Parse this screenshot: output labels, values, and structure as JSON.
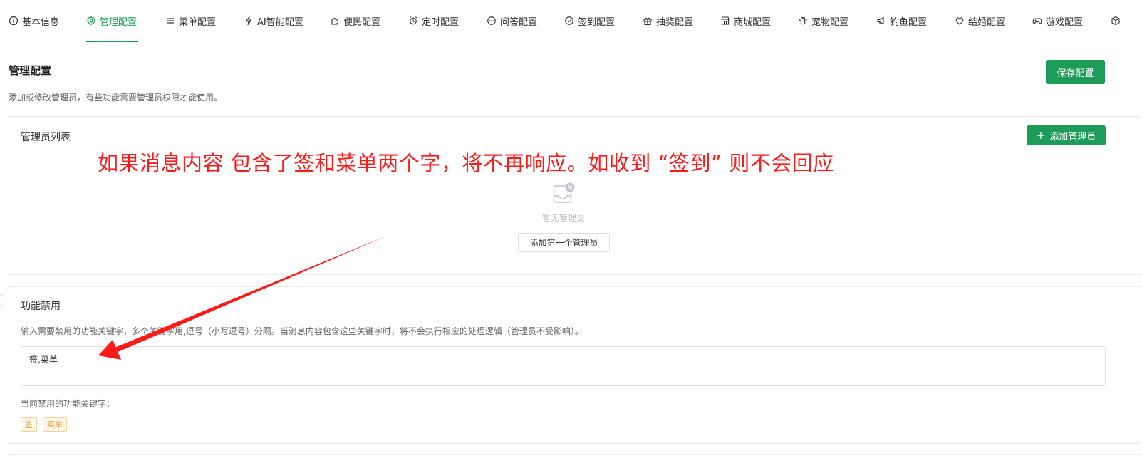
{
  "tabs": [
    {
      "label": "基本信息",
      "icon": "info-icon"
    },
    {
      "label": "管理配置",
      "icon": "gear-icon"
    },
    {
      "label": "菜单配置",
      "icon": "menu-icon"
    },
    {
      "label": "AI智能配置",
      "icon": "bolt-icon"
    },
    {
      "label": "便民配置",
      "icon": "puzzle-icon"
    },
    {
      "label": "定时配置",
      "icon": "alarm-icon"
    },
    {
      "label": "问答配置",
      "icon": "chat-icon"
    },
    {
      "label": "签到配置",
      "icon": "check-circle-icon"
    },
    {
      "label": "抽奖配置",
      "icon": "gift-icon"
    },
    {
      "label": "商城配置",
      "icon": "shop-icon"
    },
    {
      "label": "宠物配置",
      "icon": "paw-icon"
    },
    {
      "label": "钓鱼配置",
      "icon": "megaphone-icon"
    },
    {
      "label": "结婚配置",
      "icon": "heart-icon"
    },
    {
      "label": "游戏配置",
      "icon": "gamepad-icon"
    }
  ],
  "active_tab": "管理配置",
  "accent_color": "#1d9b58",
  "header": {
    "title": "管理配置",
    "description": "添加或修改管理员，有些功能需要管理员权限才能使用。",
    "save_label": "保存配置"
  },
  "admin_list": {
    "title": "管理员列表",
    "add_label": "添加管理员",
    "empty_text": "暂无管理员",
    "add_first_label": "添加第一个管理员"
  },
  "feature_disable": {
    "title": "功能禁用",
    "description": "输入需要禁用的功能关键字，多个关键字用,逗号（小写逗号）分隔。当消息内容包含这些关键字时，将不会执行相应的处理逻辑（管理员不受影响）。",
    "value": "签,菜单",
    "current_label": "当前禁用的功能关键字：",
    "tags": [
      "签",
      "菜单"
    ]
  },
  "annotation": {
    "text": "如果消息内容 包含了签和菜单两个字，将不再响应。如收到 “签到”  则不会回应",
    "color": "#ff1a1a"
  }
}
